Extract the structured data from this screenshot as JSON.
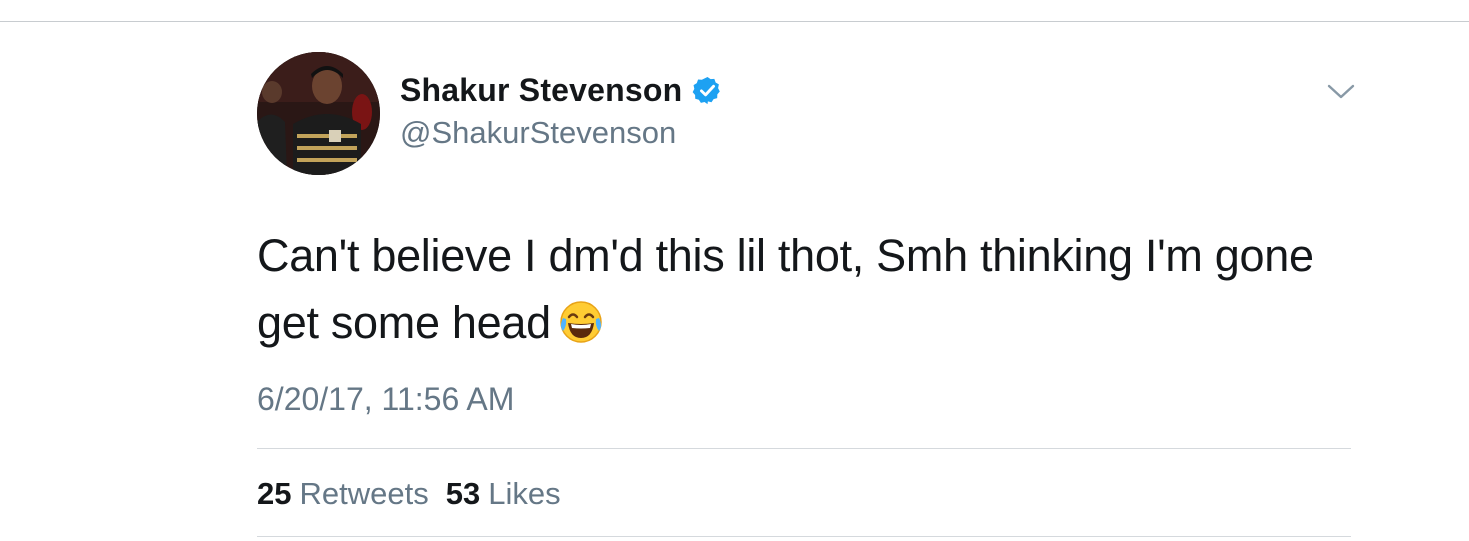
{
  "tweet": {
    "author": {
      "display_name": "Shakur Stevenson",
      "handle": "@ShakurStevenson",
      "verified": true,
      "verified_icon": "verified-badge-icon",
      "avatar": "profile-photo"
    },
    "menu_icon": "chevron-down-icon",
    "text": "Can't believe I dm'd this lil thot, Smh thinking I'm gone get some head",
    "emoji": "face-with-tears-of-joy-emoji",
    "timestamp": "6/20/17, 11:56 AM",
    "stats": {
      "retweets_count": "25",
      "retweets_label": "Retweets",
      "likes_count": "53",
      "likes_label": "Likes"
    }
  },
  "colors": {
    "text_primary": "#14171a",
    "text_secondary": "#657786",
    "verified_blue": "#1da1f2",
    "divider": "#d5d9dd"
  }
}
